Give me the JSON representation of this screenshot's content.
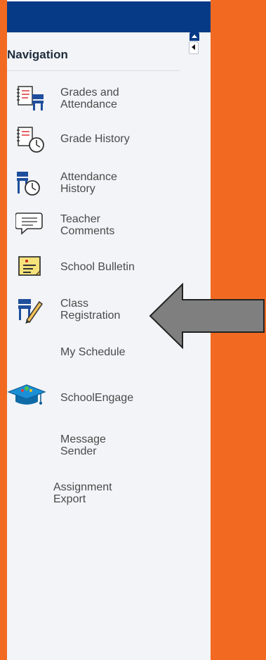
{
  "navigation": {
    "title": "Navigation",
    "items": [
      {
        "label": "Grades and\nAttendance",
        "icon": "grades-attendance-icon"
      },
      {
        "label": "Grade History",
        "icon": "grade-history-icon"
      },
      {
        "label": "Attendance\nHistory",
        "icon": "attendance-history-icon"
      },
      {
        "label": "Teacher\nComments",
        "icon": "teacher-comments-icon"
      },
      {
        "label": "School Bulletin",
        "icon": "school-bulletin-icon"
      },
      {
        "label": "Class\nRegistration",
        "icon": "class-registration-icon"
      },
      {
        "label": "My Schedule",
        "icon": ""
      },
      {
        "label": "SchoolEngage",
        "icon": "school-engage-icon"
      },
      {
        "label": "Message\nSender",
        "icon": ""
      },
      {
        "label": "Assignment\nExport",
        "icon": ""
      }
    ]
  },
  "colors": {
    "background_orange": "#f26a22",
    "topbar_blue": "#063a86",
    "sidebar_bg": "#f2f4f7",
    "text_gray": "#4a4a4a",
    "arrow_gray": "#7f7f7f"
  }
}
